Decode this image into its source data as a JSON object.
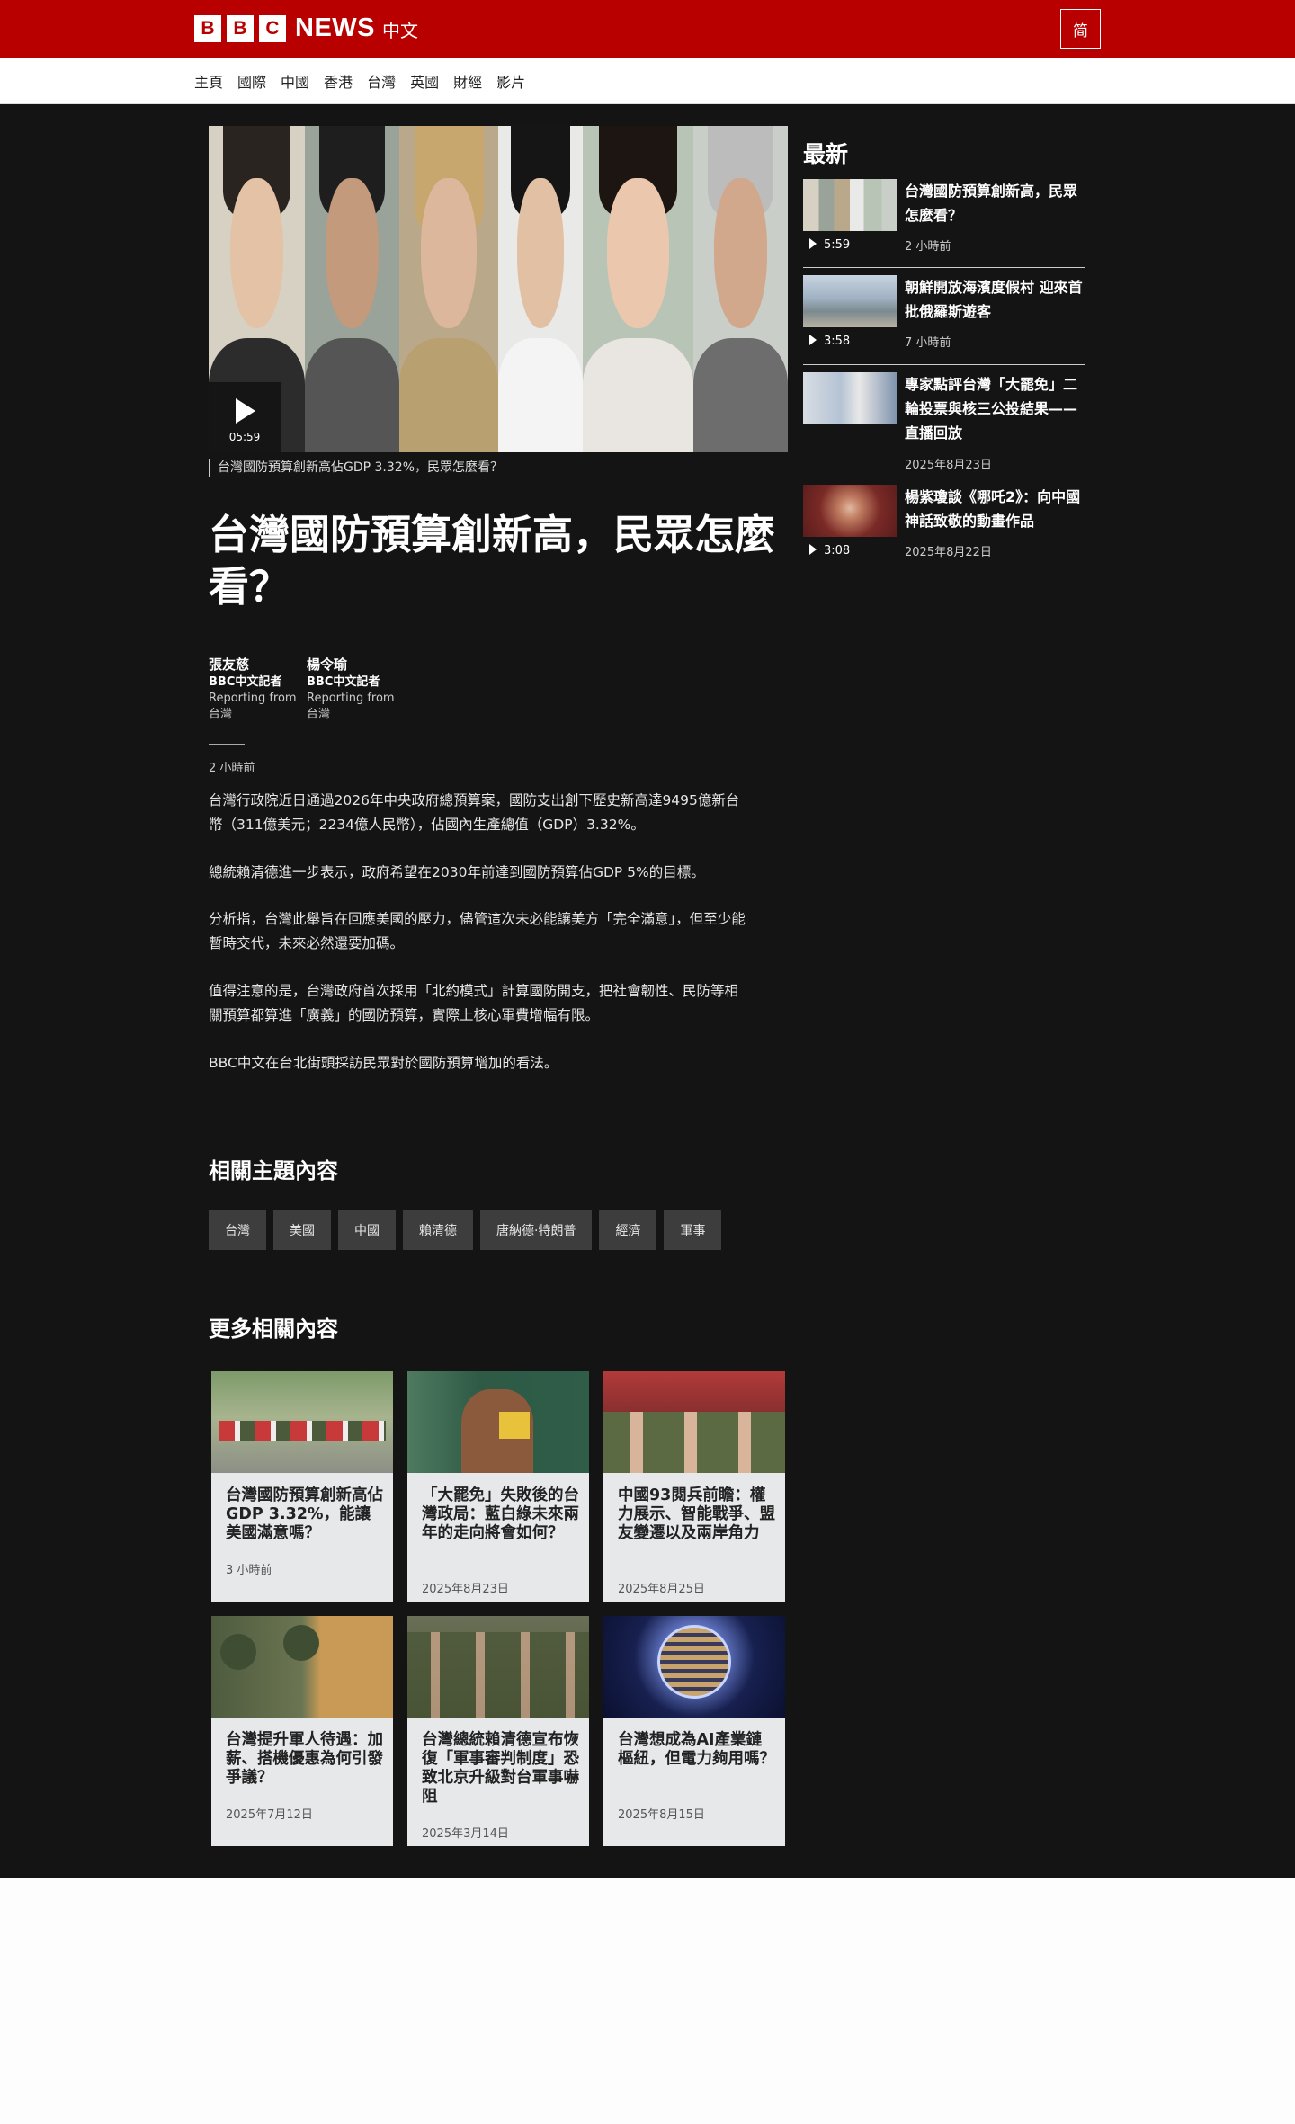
{
  "header": {
    "logo_letters": [
      "B",
      "B",
      "C"
    ],
    "logo_news": "NEWS",
    "logo_zh": "中文",
    "lang_toggle": "简",
    "brand_color": "#b80000"
  },
  "nav": {
    "items": [
      "主頁",
      "國際",
      "中國",
      "香港",
      "台灣",
      "英國",
      "財經",
      "影片"
    ]
  },
  "hero": {
    "duration": "05:59",
    "caption": "台灣國防預算創新高佔GDP 3.32%，民眾怎麼看？"
  },
  "article": {
    "headline": "台灣國防預算創新高，民眾怎麼看？",
    "authors": [
      {
        "name": "張友慈",
        "role": "BBC中文記者",
        "reporting": "Reporting from",
        "location": "台灣"
      },
      {
        "name": "楊令瑜",
        "role": "BBC中文記者",
        "reporting": "Reporting from",
        "location": "台灣"
      }
    ],
    "time": "2 小時前",
    "paragraphs": [
      "台灣行政院近日通過2026年中央政府總預算案，國防支出創下歷史新高達9495億新台幣（311億美元；2234億人民幣），佔國內生產總值（GDP）3.32%。",
      "總統賴清德進一步表示，政府希望在2030年前達到國防預算佔GDP 5%的目標。",
      "分析指，台灣此舉旨在回應美國的壓力，儘管這次未必能讓美方「完全滿意」，但至少能暫時交代，未來必然還要加碼。",
      "值得注意的是，台灣政府首次採用「北約模式」計算國防開支，把社會韌性、民防等相關預算都算進「廣義」的國防預算，實際上核心軍費增幅有限。",
      "BBC中文在台北街頭採訪民眾對於國防預算增加的看法。"
    ]
  },
  "topics": {
    "title": "相關主題內容",
    "tags": [
      "台灣",
      "美國",
      "中國",
      "賴清德",
      "唐納德·特朗普",
      "經濟",
      "軍事"
    ]
  },
  "more": {
    "title": "更多相關內容",
    "cards": [
      {
        "headline": "台灣國防預算創新高佔GDP 3.32%，能讓美國滿意嗎？",
        "date": "3 小時前"
      },
      {
        "headline": "「大罷免」失敗後的台灣政局：藍白綠未來兩年的走向將會如何？",
        "date": "2025年8月23日"
      },
      {
        "headline": "中國93閱兵前瞻：權力展示、智能戰爭、盟友變遷以及兩岸角力",
        "date": "2025年8月25日"
      },
      {
        "headline": "台灣提升軍人待遇：加薪、搭機優惠為何引發爭議？",
        "date": "2025年7月12日"
      },
      {
        "headline": "台灣總統賴清德宣布恢復「軍事審判制度」恐致北京升級對台軍事嚇阻",
        "date": "2025年3月14日"
      },
      {
        "headline": "台灣想成為AI產業鏈樞紐，但電力夠用嗎？",
        "date": "2025年8月15日"
      }
    ]
  },
  "sidebar": {
    "title": "最新",
    "items": [
      {
        "headline": "台灣國防預算創新高，民眾怎麼看？",
        "duration": "5:59",
        "time": "2 小時前"
      },
      {
        "headline": "朝鮮開放海濱度假村 迎來首批俄羅斯遊客",
        "duration": "3:58",
        "time": "7 小時前"
      },
      {
        "headline": "專家點評台灣「大罷免」二輪投票與核三公投結果——直播回放",
        "duration": "",
        "time": "2025年8月23日"
      },
      {
        "headline": "楊紫瓊談《哪吒2》：向中國神話致敬的動畫作品",
        "duration": "3:08",
        "time": "2025年8月22日"
      }
    ]
  }
}
